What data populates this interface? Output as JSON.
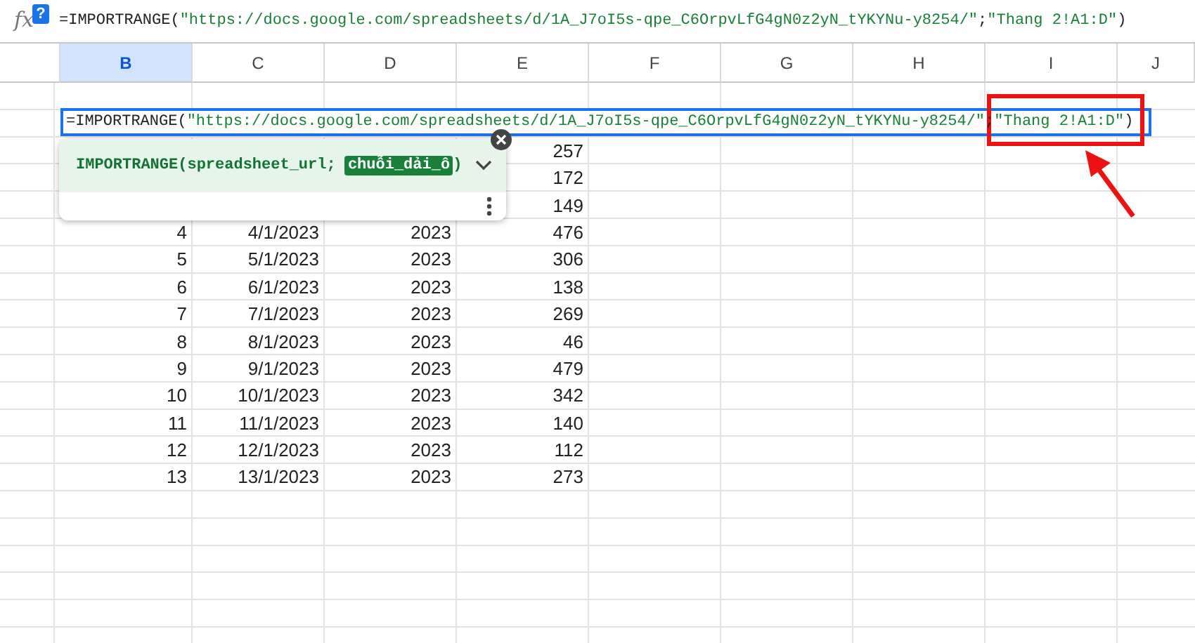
{
  "formula_bar": {
    "icon_label": "fx",
    "help_badge": "?",
    "segments": [
      {
        "text": "=IMPORTRANGE(",
        "kind": "plain"
      },
      {
        "text": "\"https://docs.google.com/spreadsheets/d/1A_J7oI5s-qpe_C6OrpvLfG4gN0z2yN_tYKYNu-y8254/\"",
        "kind": "string"
      },
      {
        "text": ";",
        "kind": "plain"
      },
      {
        "text": "\"Thang 2!A1:D\"",
        "kind": "string"
      },
      {
        "text": ")",
        "kind": "plain"
      }
    ]
  },
  "columns": [
    {
      "label": "B",
      "selected": true
    },
    {
      "label": "C",
      "selected": false
    },
    {
      "label": "D",
      "selected": false
    },
    {
      "label": "E",
      "selected": false
    },
    {
      "label": "F",
      "selected": false
    },
    {
      "label": "G",
      "selected": false
    },
    {
      "label": "H",
      "selected": false
    },
    {
      "label": "I",
      "selected": false
    },
    {
      "label": "J",
      "selected": false
    }
  ],
  "cell_editor": {
    "segments": [
      {
        "text": "=IMPORTRANGE(",
        "kind": "plain"
      },
      {
        "text": "\"https://docs.google.com/spreadsheets/d/1A_J7oI5s-qpe_C6OrpvLfG4gN0z2yN_tYKYNu-y8254/\"",
        "kind": "string"
      },
      {
        "text": ";",
        "kind": "plain"
      },
      {
        "text": "\"Thang 2!A1:D\"",
        "kind": "string"
      },
      {
        "text": ")",
        "kind": "plain"
      }
    ]
  },
  "formula_hint": {
    "expanded": false,
    "segments": [
      {
        "text": "IMPORTRANGE(spreadsheet_url; ",
        "kind": "plain"
      },
      {
        "text": "chuỗi_dải_ô",
        "kind": "active"
      },
      {
        "text": ")",
        "kind": "plain"
      }
    ]
  },
  "rows": [
    {
      "e": "257"
    },
    {
      "e": "172"
    },
    {
      "e": "149"
    },
    {
      "b": "4",
      "c": "4/1/2023",
      "d": "2023",
      "e": "476"
    },
    {
      "b": "5",
      "c": "5/1/2023",
      "d": "2023",
      "e": "306"
    },
    {
      "b": "6",
      "c": "6/1/2023",
      "d": "2023",
      "e": "138"
    },
    {
      "b": "7",
      "c": "7/1/2023",
      "d": "2023",
      "e": "269"
    },
    {
      "b": "8",
      "c": "8/1/2023",
      "d": "2023",
      "e": "46"
    },
    {
      "b": "9",
      "c": "9/1/2023",
      "d": "2023",
      "e": "479"
    },
    {
      "b": "10",
      "c": "10/1/2023",
      "d": "2023",
      "e": "342"
    },
    {
      "b": "11",
      "c": "11/1/2023",
      "d": "2023",
      "e": "140"
    },
    {
      "b": "12",
      "c": "12/1/2023",
      "d": "2023",
      "e": "112"
    },
    {
      "b": "13",
      "c": "13/1/2023",
      "d": "2023",
      "e": "273"
    }
  ]
}
